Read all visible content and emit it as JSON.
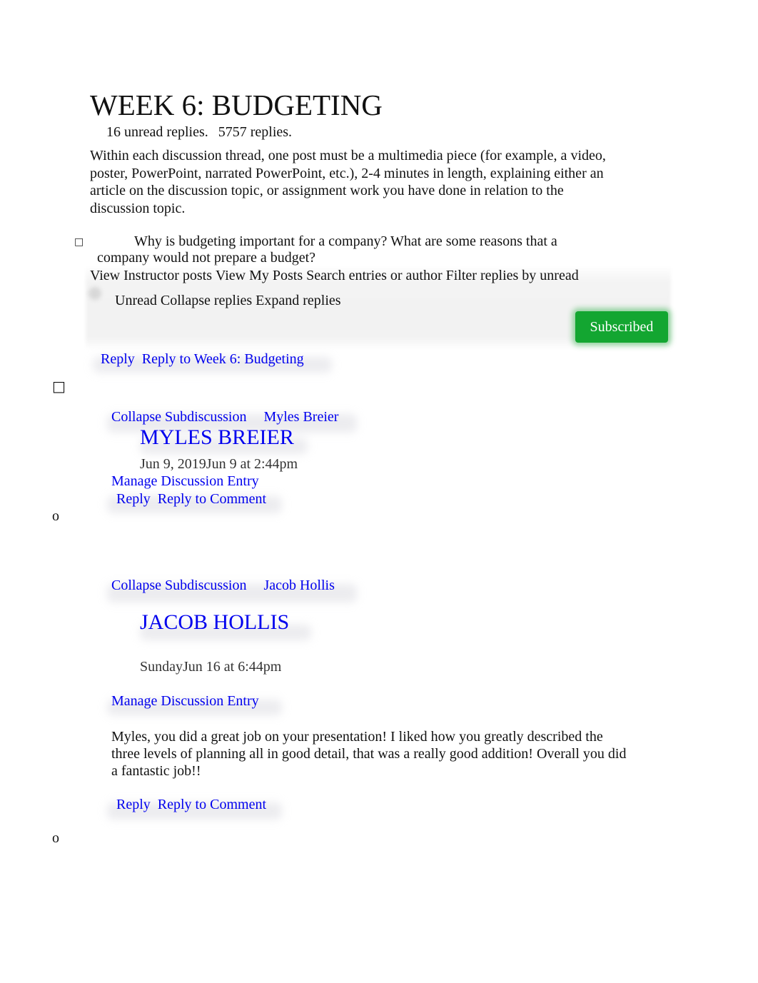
{
  "page": {
    "title": "WEEK 6: BUDGETING",
    "unread_replies": "16 unread replies.",
    "reply_count_prefix": "57",
    "reply_count": "57 replies.",
    "description": "Within each discussion thread, one post must be a multimedia piece (for example, a video, poster, PowerPoint, narrated PowerPoint, etc.), 2-4 minutes in length, explaining either an article on the discussion topic, or assignment work you have done in relation to the discussion topic.",
    "question_bullet": "□",
    "question": "Why is budgeting important for a company? What are some reasons that a company would not prepare a budget?"
  },
  "toolbar": {
    "view_instructor_posts": "View Instructor posts",
    "view_my_posts": "View My Posts",
    "search_placeholder": "Search entries or author",
    "filter_label": "Filter replies by unread",
    "unread": "Unread",
    "collapse_replies": "Collapse replies",
    "expand_replies": "Expand replies",
    "subscribed": "Subscribed"
  },
  "topic_reply": {
    "reply": "Reply",
    "reply_to": "Reply to Week 6: Budgeting"
  },
  "list_markers": {
    "square": "□",
    "circle": "o"
  },
  "entries": [
    {
      "collapse": "Collapse Subdiscussion",
      "author_link": "Myles Breier",
      "author_heading": "MYLES BREIER",
      "date": "Jun 9, 2019Jun 9 at 2:44pm",
      "manage": "Manage Discussion Entry",
      "body": "",
      "reply": "Reply",
      "reply_to": "Reply to Comment"
    },
    {
      "collapse": "Collapse Subdiscussion",
      "author_link": "Jacob Hollis",
      "author_heading": "JACOB HOLLIS",
      "date": "SundayJun 16 at 6:44pm",
      "manage": "Manage Discussion Entry",
      "body": "Myles, you did a great job on your presentation! I liked how you greatly described the three levels of planning all in good detail, that was a really good addition! Overall you did a fantastic job!!",
      "reply": "Reply",
      "reply_to": "Reply to Comment"
    }
  ],
  "colors": {
    "link": "#0000ee",
    "subscribed_bg": "#13a631",
    "text": "#111111"
  }
}
